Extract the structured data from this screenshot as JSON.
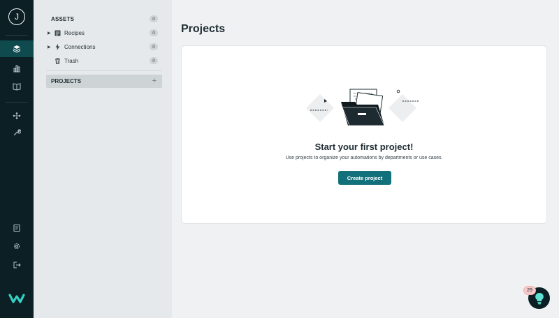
{
  "user": {
    "initial": "J"
  },
  "rail": {
    "items": [
      {
        "icon": "layers-icon",
        "active": true
      },
      {
        "icon": "bar-chart-icon",
        "active": false
      },
      {
        "icon": "book-icon",
        "active": false
      },
      {
        "icon": "network-icon",
        "active": false
      },
      {
        "icon": "wrench-icon",
        "active": false
      },
      {
        "icon": "document-list-icon",
        "active": false
      },
      {
        "icon": "gear-icon",
        "active": false
      },
      {
        "icon": "logout-icon",
        "active": false
      }
    ],
    "logo": "workato-logo"
  },
  "sidebar": {
    "assets_label": "ASSETS",
    "assets_count": "0",
    "items": [
      {
        "label": "Recipes",
        "count": "0",
        "icon": "recipe-icon"
      },
      {
        "label": "Connections",
        "count": "0",
        "icon": "lightning-icon"
      },
      {
        "label": "Trash",
        "count": "0",
        "icon": "trash-icon"
      }
    ],
    "projects_label": "PROJECTS"
  },
  "main": {
    "title": "Projects",
    "empty_title": "Start your first project!",
    "empty_subtitle": "Use projects to organize your automations by departments or use cases.",
    "create_button": "Create project"
  },
  "help": {
    "badge": "29",
    "icon": "lightbulb-icon"
  },
  "colors": {
    "rail": "#0b1f24",
    "accent": "#12707a",
    "active": "#0f4a4f"
  }
}
